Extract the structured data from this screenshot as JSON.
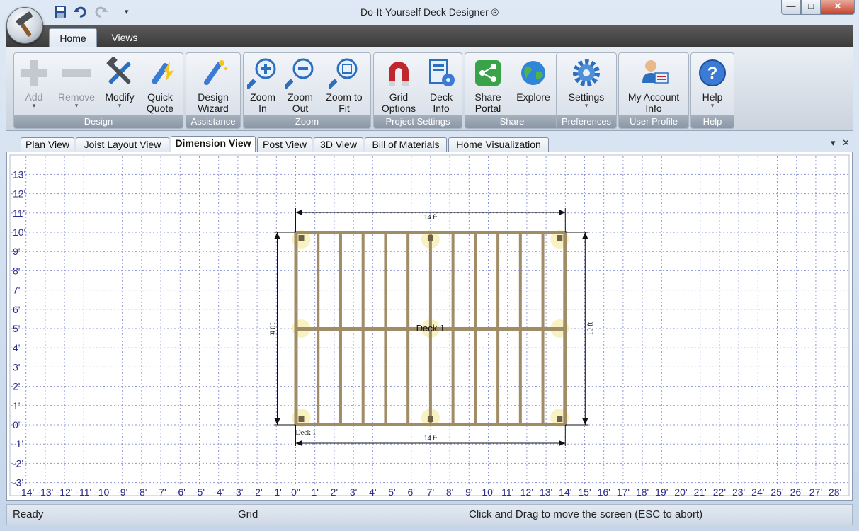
{
  "window": {
    "title": "Do-It-Yourself Deck Designer ®",
    "controls": {
      "minimize": "—",
      "maximize": "□",
      "close": "✕"
    }
  },
  "quick_access": {
    "save_icon": "save-icon",
    "undo_icon": "undo-icon",
    "redo_icon": "redo-icon",
    "menu_caret": "▾"
  },
  "ribbon_tabs": [
    {
      "label": "Home",
      "active": true
    },
    {
      "label": "Views",
      "active": false
    }
  ],
  "ribbon_groups": [
    {
      "label": "Design",
      "buttons": [
        {
          "line1": "Add",
          "line2": "",
          "caret": "▾",
          "enabled": false,
          "icon": "plus-icon"
        },
        {
          "line1": "Remove",
          "line2": "",
          "caret": "▾",
          "enabled": false,
          "icon": "minus-icon"
        },
        {
          "line1": "Modify",
          "line2": "",
          "caret": "▾",
          "enabled": true,
          "icon": "tools-icon"
        },
        {
          "line1": "Quick",
          "line2": "Quote",
          "caret": "",
          "enabled": true,
          "icon": "quote-wand-icon"
        }
      ]
    },
    {
      "label": "Assistance",
      "buttons": [
        {
          "line1": "Design",
          "line2": "Wizard",
          "caret": "",
          "enabled": true,
          "icon": "magic-wand-icon"
        }
      ]
    },
    {
      "label": "Zoom",
      "buttons": [
        {
          "line1": "Zoom",
          "line2": "In",
          "caret": "",
          "enabled": true,
          "icon": "zoom-in-icon"
        },
        {
          "line1": "Zoom",
          "line2": "Out",
          "caret": "",
          "enabled": true,
          "icon": "zoom-out-icon"
        },
        {
          "line1": "Zoom to",
          "line2": "Fit",
          "caret": "",
          "enabled": true,
          "icon": "zoom-fit-icon"
        }
      ]
    },
    {
      "label": "Project Settings",
      "buttons": [
        {
          "line1": "Grid",
          "line2": "Options",
          "caret": "",
          "enabled": true,
          "icon": "magnet-icon"
        },
        {
          "line1": "Deck",
          "line2": "Info",
          "caret": "",
          "enabled": true,
          "icon": "deck-info-icon"
        }
      ]
    },
    {
      "label": "Share",
      "buttons": [
        {
          "line1": "Share",
          "line2": "Portal",
          "caret": "",
          "enabled": true,
          "icon": "share-icon"
        },
        {
          "line1": "Explore",
          "line2": "",
          "caret": "",
          "enabled": true,
          "icon": "globe-icon"
        }
      ]
    },
    {
      "label": "Preferences",
      "buttons": [
        {
          "line1": "Settings",
          "line2": "",
          "caret": "▾",
          "enabled": true,
          "icon": "gear-icon"
        }
      ]
    },
    {
      "label": "User Profile",
      "buttons": [
        {
          "line1": "My Account",
          "line2": "Info",
          "caret": "",
          "enabled": true,
          "icon": "user-card-icon"
        }
      ]
    },
    {
      "label": "Help",
      "buttons": [
        {
          "line1": "Help",
          "line2": "",
          "caret": "▾",
          "enabled": true,
          "icon": "help-icon"
        }
      ]
    }
  ],
  "doc_tabs": [
    {
      "label": "Plan View",
      "active": false
    },
    {
      "label": "Joist Layout View",
      "active": false
    },
    {
      "label": "Dimension View",
      "active": true
    },
    {
      "label": "Post View",
      "active": false
    },
    {
      "label": "3D View",
      "active": false
    },
    {
      "label": "Bill of Materials",
      "active": false
    },
    {
      "label": "Home Visualization",
      "active": false
    }
  ],
  "doc_tab_controls": {
    "dropdown": "▾",
    "close": "✕"
  },
  "canvas": {
    "y_axis_labels": [
      "13'",
      "12'",
      "11'",
      "10'",
      "9'",
      "8'",
      "7'",
      "6'",
      "5'",
      "4'",
      "3'",
      "2'",
      "1'",
      "0\"",
      "-1'",
      "-2'",
      "-3'"
    ],
    "x_axis_labels": [
      "-14'",
      "-13'",
      "-12'",
      "-11'",
      "-10'",
      "-9'",
      "-8'",
      "-7'",
      "-6'",
      "-5'",
      "-4'",
      "-3'",
      "-2'",
      "-1'",
      "0\"",
      "1'",
      "2'",
      "3'",
      "4'",
      "5'",
      "6'",
      "7'",
      "8'",
      "9'",
      "10'",
      "11'",
      "12'",
      "13'",
      "14'",
      "15'",
      "16'",
      "17'",
      "18'",
      "19'",
      "20'",
      "21'",
      "22'",
      "23'",
      "24'",
      "25'",
      "26'",
      "27'",
      "28'"
    ],
    "deck": {
      "name": "Deck 1",
      "corner_label": "Deck 1",
      "width_ft": 14,
      "depth_ft": 10,
      "joist_count": 11,
      "beam_at_ft": 5,
      "top_dimension": "14 ft",
      "bottom_dimension": "14 ft",
      "left_dimension": "10 ft",
      "right_dimension": "10 ft",
      "frame_color": "#a08c66",
      "post_color": "#6f5f43"
    },
    "grid_color": "#8d95d6",
    "axis_label_color": "#2d2d8c"
  },
  "status": {
    "ready": "Ready",
    "mode": "Grid",
    "hint": "Click and Drag to move the screen  (ESC to abort)"
  }
}
